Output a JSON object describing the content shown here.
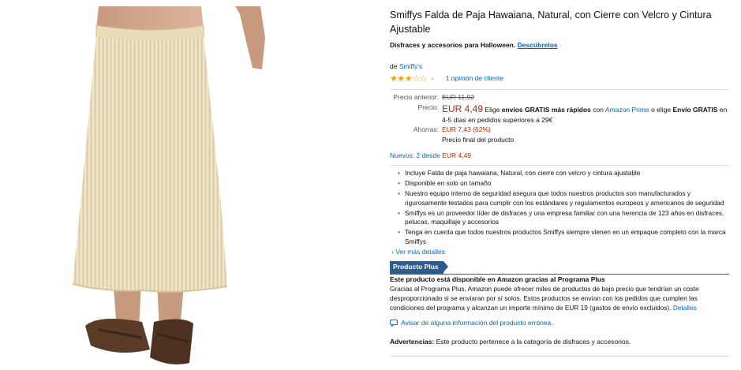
{
  "product": {
    "title": "Smiffys Falda de Paja Hawaiana, Natural, con Cierre con Velcro y Cintura Ajustable",
    "category_text": "Disfraces y accesorios para Halloween.",
    "category_link": "Descúbrelos",
    "brand_prefix": "de",
    "brand": "Smiffy's",
    "rating_stars": "★★★☆☆",
    "rating_chevron": "⌄",
    "reviews_link": "1 opinión de cliente"
  },
  "pricing": {
    "previous_label": "Precio anterior:",
    "previous_value": "EUR 11,92",
    "price_label": "Precio:",
    "price_value": "EUR 4,49",
    "shipping_pre": "Elige",
    "shipping_bold": "envíos GRATIS más rápidos",
    "shipping_mid": "con",
    "shipping_link": "Amazon Prime",
    "shipping_or": "o elige",
    "shipping_bold2": "Envío GRATIS",
    "shipping_post": "en 4-5 días en pedidos superiores a 29€",
    "savings_label": "Ahorras:",
    "savings_value": "EUR 7,43 (62%)",
    "final_note": "Precio final del producto"
  },
  "offers": {
    "new_label": "Nuevos: 2 desde",
    "new_price": "EUR 4,49"
  },
  "bullets": [
    "Incluye Falda de paja hawaiana, Natural, con cierre con velcro y cintura ajustable",
    "Disponible en solo un tamaño",
    "Nuestro equipo interno de seguridad asegura que todos nuestros productos son manufacturados y rigurosamente testados para cumplir con los estándares y regulamentos europeos y americanos de seguridad",
    "Smiffys es un proveedor líder de disfraces y una empresa familiar con una herencia de 123 años en disfraces, pelucas, maquillaje y accesorios",
    "Tenga en cuenta que todos nuestros productos Smiffys siempre vienen en un empaque completo con la marca Smiffys"
  ],
  "see_more": "› Ver más detalles",
  "plus": {
    "badge": "Producto Plus",
    "heading": "Este producto está disponible en Amazon gracias al Programa Plus",
    "body": "Gracias al Programa Plus, Amazon puede ofrecer miles de productos de bajo precio que tendrían un coste desproporcionado si se enviaran por sí solos. Estos productos se envían con los pedidos que cumplen las condiciones del programa y alcanzan un importe mínimo de EUR 19 (gastos de envío excluidos).",
    "details_link": "Detalles"
  },
  "report": {
    "icon": "comment-icon",
    "text": "Avisar de alguna información del producto errónea."
  },
  "warning": {
    "label": "Advertencias:",
    "text": "Este producto pertenece a la categoría de disfraces y accesorios."
  },
  "colors": {
    "link": "#0066c0",
    "price_red": "#b12704",
    "star": "#f0a30c",
    "plus_badge": "#2d5c8f"
  }
}
